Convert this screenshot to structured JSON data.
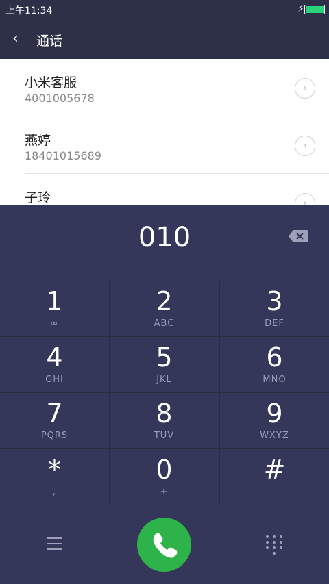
{
  "status": {
    "time": "上午11:34",
    "battery_color": "#2bd47b"
  },
  "header": {
    "back": "‹",
    "title": "通话"
  },
  "contacts": [
    {
      "name": "小米客服",
      "number": "4001005678"
    },
    {
      "name": "燕婷",
      "number": "18401015689"
    },
    {
      "name": "子玲",
      "number": ""
    }
  ],
  "dial": {
    "digits": "010"
  },
  "keys": [
    {
      "digit": "1",
      "letters": "∞"
    },
    {
      "digit": "2",
      "letters": "ABC"
    },
    {
      "digit": "3",
      "letters": "DEF"
    },
    {
      "digit": "4",
      "letters": "GHI"
    },
    {
      "digit": "5",
      "letters": "JKL"
    },
    {
      "digit": "6",
      "letters": "MNO"
    },
    {
      "digit": "7",
      "letters": "PQRS"
    },
    {
      "digit": "8",
      "letters": "TUV"
    },
    {
      "digit": "9",
      "letters": "WXYZ"
    },
    {
      "digit": "*",
      "letters": ","
    },
    {
      "digit": "0",
      "letters": "+"
    },
    {
      "digit": "#",
      "letters": ""
    }
  ],
  "colors": {
    "accent_green": "#2db34a",
    "panel": "#34365a",
    "background": "#2e3048"
  }
}
